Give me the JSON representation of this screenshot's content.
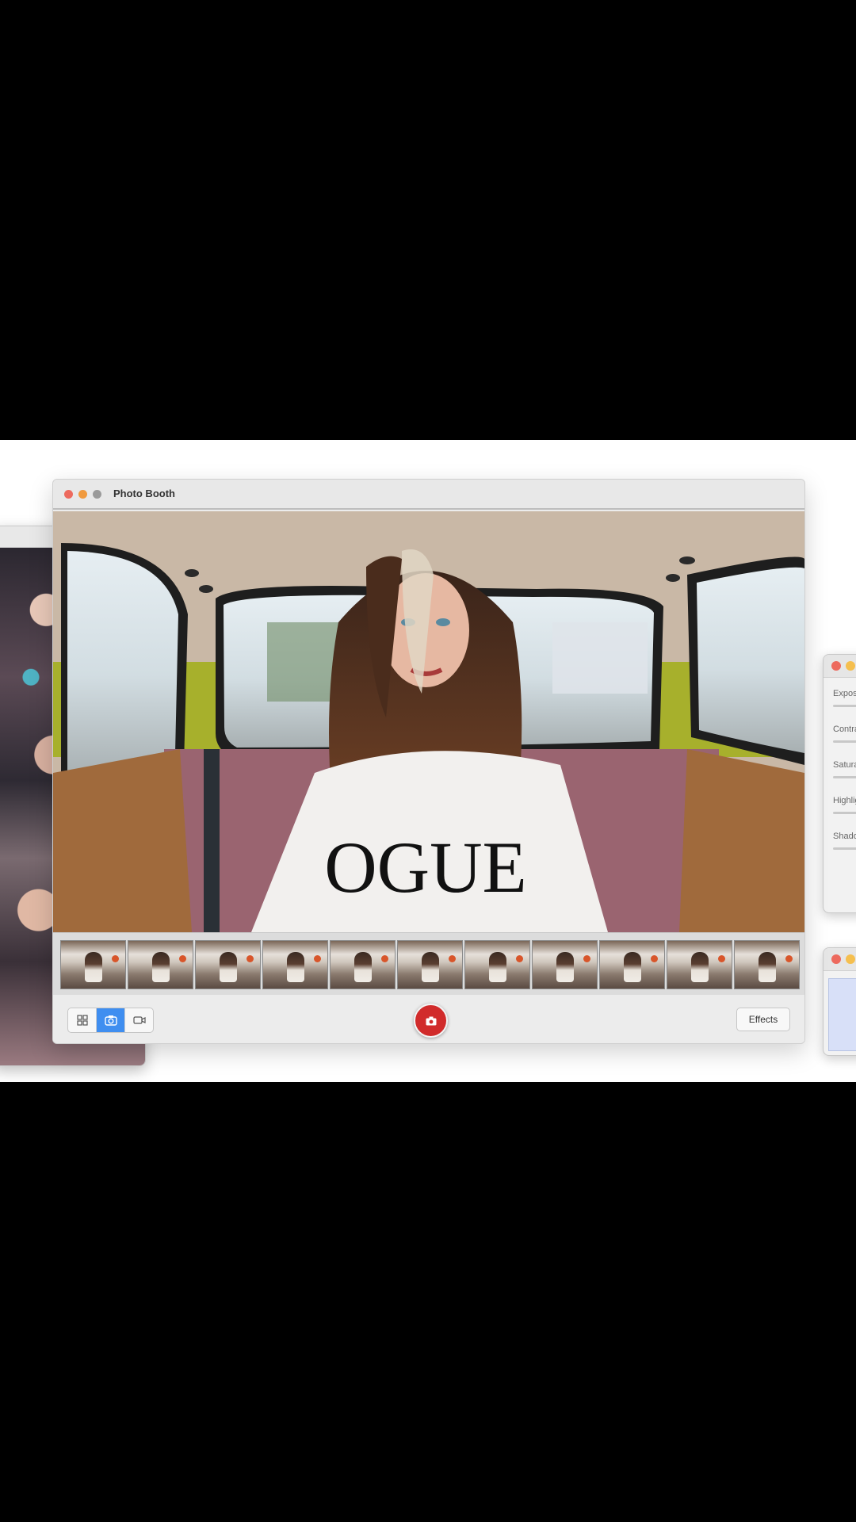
{
  "window": {
    "title": "Photo Booth"
  },
  "toolbar": {
    "view_modes": [
      {
        "name": "grid",
        "icon": "grid-icon"
      },
      {
        "name": "photo",
        "icon": "camera-icon",
        "active": true
      },
      {
        "name": "video",
        "icon": "video-icon"
      }
    ],
    "effects_label": "Effects"
  },
  "preview": {
    "shirt_text": "OGUE"
  },
  "filmstrip": {
    "count": 11
  },
  "adjustments": {
    "labels": [
      "Exposu",
      "Contra",
      "Satura",
      "Highlig",
      "Shado"
    ]
  },
  "colors": {
    "close": "#ed6a5e",
    "minimize": "#f5bf4f",
    "zoom": "#9a9a9a",
    "accent": "#3f8ef0",
    "shutter": "#d12b2b"
  }
}
